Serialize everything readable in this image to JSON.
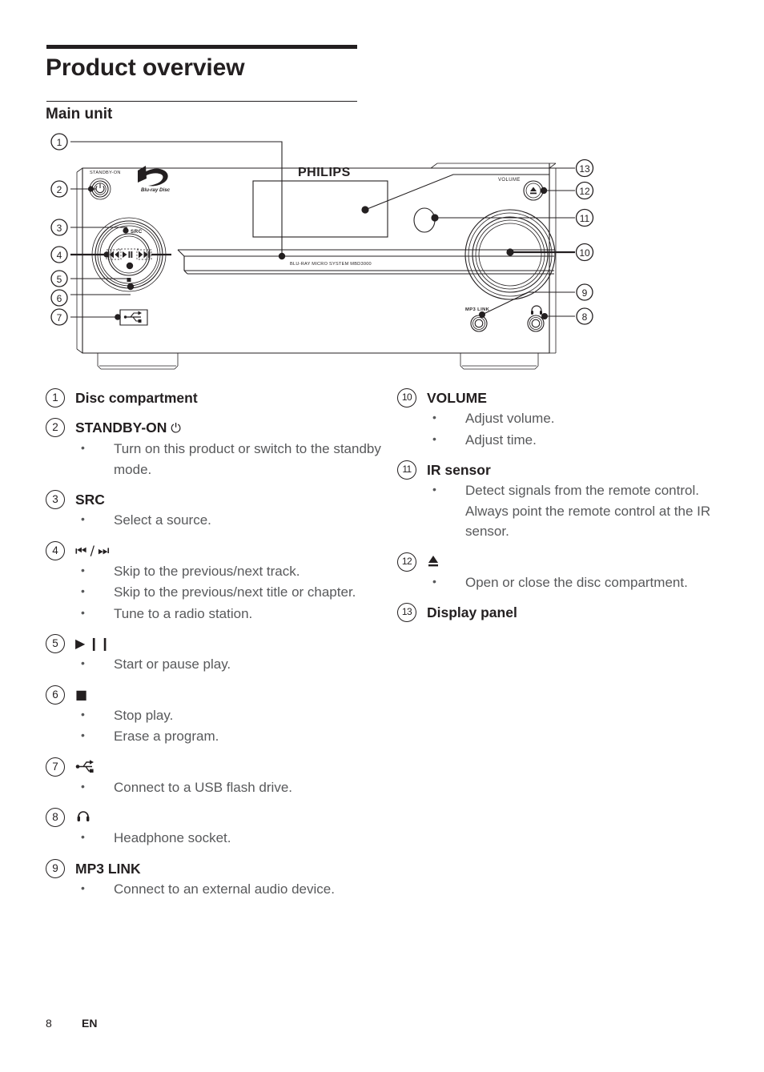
{
  "header": {
    "title": "Product overview",
    "section": "Main unit"
  },
  "diagram": {
    "brand": "PHILIPS",
    "standby_label": "STANDBY-ON",
    "bluray_logo": "Blu-ray Disc",
    "model_text": "BLU-RAY MICRO SYSTEM MBD3000",
    "src_label": "SRC",
    "volume_label": "VOLUME",
    "mp3_link_label": "MP3 LINK",
    "headphone_label": "headphone-icon",
    "usb_label": "usb-icon",
    "eject_label": "eject-icon",
    "power_label": "power-icon",
    "callouts_left": [
      "1",
      "2",
      "3",
      "4",
      "5",
      "6",
      "7"
    ],
    "callouts_right": [
      "13",
      "12",
      "11",
      "10",
      "9",
      "8"
    ]
  },
  "legend": {
    "left": [
      {
        "num": "1",
        "label": "Disc compartment",
        "symbol": "",
        "bullets": []
      },
      {
        "num": "2",
        "label": "STANDBY-ON",
        "symbol": "⏻",
        "bullets": [
          "Turn on this product or switch to the standby mode."
        ]
      },
      {
        "num": "3",
        "label": "SRC",
        "symbol": "",
        "bullets": [
          "Select a source."
        ]
      },
      {
        "num": "4",
        "label": "",
        "symbol": "⏮ / ⏭",
        "bullets": [
          "Skip to the previous/next track.",
          "Skip to the previous/next title or chapter.",
          "Tune to a radio station."
        ]
      },
      {
        "num": "5",
        "label": "",
        "symbol": "▶ ❙❙",
        "bullets": [
          "Start or pause play."
        ]
      },
      {
        "num": "6",
        "label": "",
        "symbol": "■",
        "bullets": [
          "Stop play.",
          "Erase a program."
        ]
      },
      {
        "num": "7",
        "label": "",
        "symbol": "usb-icon",
        "bullets": [
          "Connect to a USB flash drive."
        ]
      },
      {
        "num": "8",
        "label": "",
        "symbol": "headphone-icon",
        "bullets": [
          "Headphone socket."
        ]
      },
      {
        "num": "9",
        "label": "MP3 LINK",
        "symbol": "",
        "bullets": [
          "Connect to an external audio device."
        ]
      }
    ],
    "right": [
      {
        "num": "10",
        "label": "VOLUME",
        "symbol": "",
        "bullets": [
          "Adjust volume.",
          "Adjust time."
        ]
      },
      {
        "num": "11",
        "label": "IR sensor",
        "symbol": "",
        "bullets": [
          "Detect signals from the remote control. Always point the remote control at the IR sensor."
        ]
      },
      {
        "num": "12",
        "label": "",
        "symbol": "⏏",
        "bullets": [
          "Open or close the disc compartment."
        ]
      },
      {
        "num": "13",
        "label": "Display panel",
        "symbol": "",
        "bullets": []
      }
    ]
  },
  "footer": {
    "page_number": "8",
    "language": "EN"
  }
}
